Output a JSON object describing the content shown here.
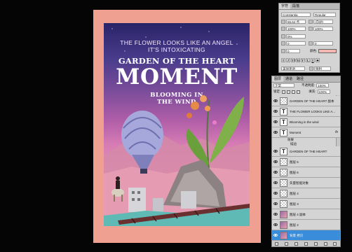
{
  "poster": {
    "subtitle_line1": "THE FLOWER LOOKS LIKE AN ANGEL",
    "subtitle_line2": "IT'S INTOXICATING",
    "title_line1": "GARDEN OF THE HEART",
    "title_line2": "MOMENT",
    "bloom_line1": "BLOOMING IN",
    "bloom_line2": "THE WIND"
  },
  "character_panel": {
    "tabs": [
      "字符",
      "段落"
    ],
    "font_family": "Constantia",
    "font_style": "Regular",
    "font_size": "66.64 点",
    "leading": "(自动)",
    "tracking_left": "100%",
    "tracking_right": "100%",
    "kerning": "0%",
    "baseline": "0",
    "baseline2": "0",
    "color_label": "颜色:",
    "color_hex": "#f4b8b2",
    "format_buttons": [
      "T",
      "T",
      "TT",
      "Tr",
      "T'",
      "T,",
      "T",
      "T"
    ],
    "language": "美国英语",
    "antialias": "锐利"
  },
  "layers_panel": {
    "tabs": [
      "图层",
      "通道",
      "路径"
    ],
    "blend_mode": "正常",
    "opacity_label": "不透明度:",
    "opacity": "100%",
    "lock_label": "锁定:",
    "fill_label": "填充:",
    "fill": "100%",
    "layers": [
      {
        "name": "GARDEN OF THE HEART 副本",
        "type": "blank",
        "visible": true,
        "selected": false,
        "fx": false
      },
      {
        "name": "THE FLOWER LOOKS LIKE A...",
        "type": "text",
        "visible": true,
        "selected": false,
        "fx": false
      },
      {
        "name": "Blooming in  the wind",
        "type": "text",
        "visible": true,
        "selected": false,
        "fx": false
      },
      {
        "name": "Moment",
        "type": "text",
        "visible": true,
        "selected": false,
        "fx": true
      },
      {
        "name": "GARDEN OF THE HEART",
        "type": "text",
        "visible": true,
        "selected": false,
        "fx": false
      },
      {
        "name": "图层 5",
        "type": "blank",
        "visible": true,
        "selected": false,
        "fx": false
      },
      {
        "name": "图层 6",
        "type": "blank",
        "visible": true,
        "selected": false,
        "fx": false
      },
      {
        "name": "矢量智能对象",
        "type": "blank",
        "visible": true,
        "selected": false,
        "fx": false
      },
      {
        "name": "图层 4",
        "type": "blank",
        "visible": true,
        "selected": false,
        "fx": false
      },
      {
        "name": "图层 3",
        "type": "blank",
        "visible": true,
        "selected": false,
        "fx": false
      },
      {
        "name": "图层 4 副本",
        "type": "img",
        "visible": true,
        "selected": false,
        "fx": false
      },
      {
        "name": "图层 2",
        "type": "img",
        "visible": true,
        "selected": false,
        "fx": false
      },
      {
        "name": "背景 拷贝",
        "type": "img",
        "visible": true,
        "selected": true,
        "fx": false
      }
    ],
    "effects_label": "效果",
    "effect_name": "描边"
  }
}
